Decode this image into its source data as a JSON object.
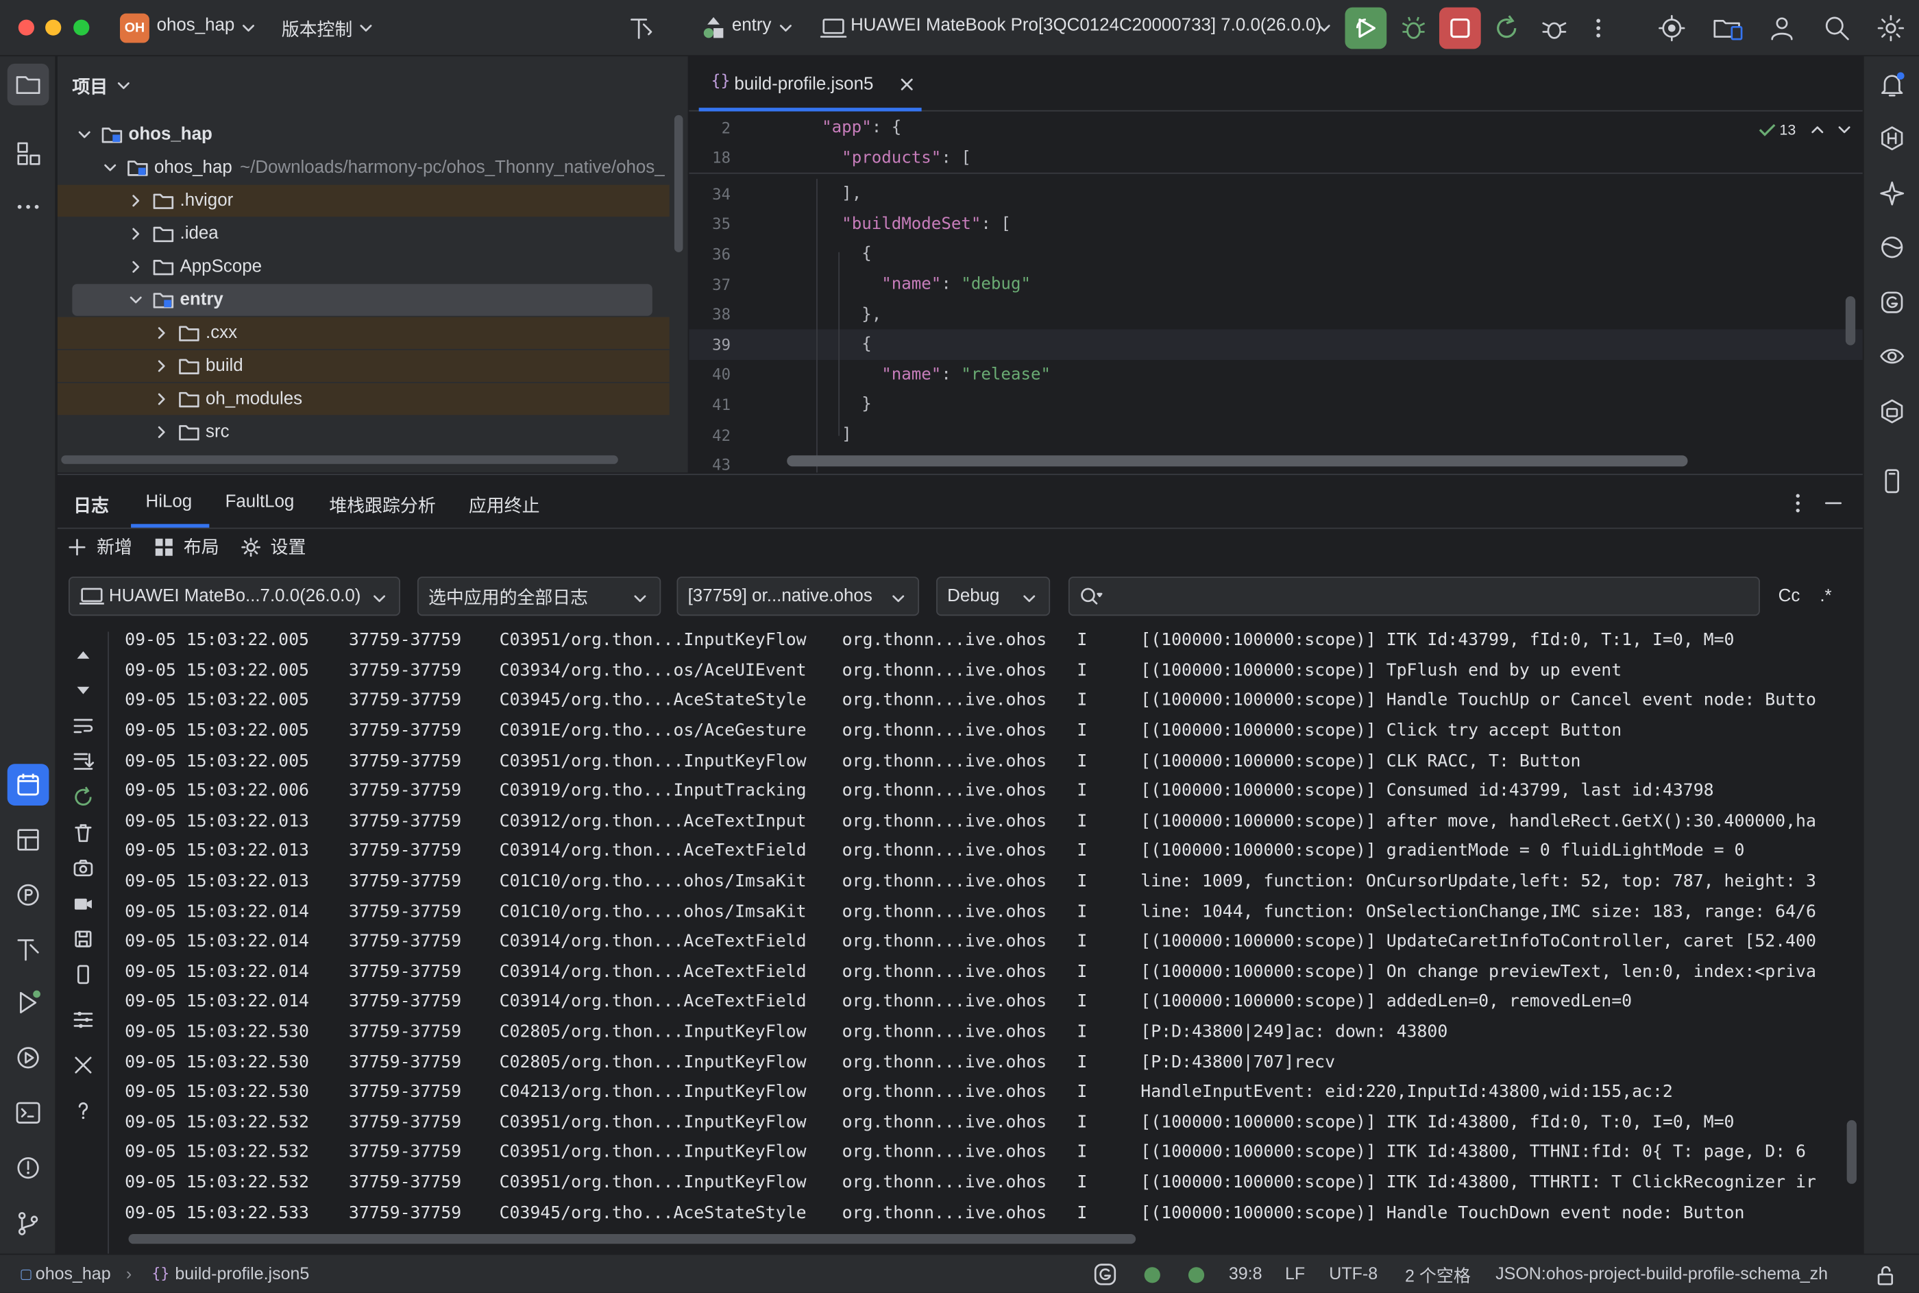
{
  "titlebar": {
    "project_badge": "OH",
    "project_name": "ohos_hap",
    "vcs_menu": "版本控制",
    "run_config": "entry",
    "device": "HUAWEI MateBook Pro[3QC0124C20000733] 7.0.0(26.0.0)",
    "colors": {
      "run_green": "#57965c",
      "stop_red": "#c94f4f",
      "badge": "#e0733e"
    }
  },
  "project_panel": {
    "title": "项目",
    "tree": [
      {
        "label": "ohos_hap",
        "bold": true,
        "expanded": true,
        "level": 0,
        "type": "module"
      },
      {
        "label": "ohos_hap",
        "path": "~/Downloads/harmony-pc/ohos_Thonny_native/ohos_",
        "expanded": true,
        "level": 1,
        "type": "module"
      },
      {
        "label": ".hvigor",
        "level": 2,
        "type": "folder",
        "excluded": true
      },
      {
        "label": ".idea",
        "level": 2,
        "type": "folder"
      },
      {
        "label": "AppScope",
        "level": 2,
        "type": "folder"
      },
      {
        "label": "entry",
        "bold": true,
        "expanded": true,
        "level": 2,
        "type": "module",
        "selected": true
      },
      {
        "label": ".cxx",
        "level": 3,
        "type": "folder",
        "excluded": true
      },
      {
        "label": "build",
        "level": 3,
        "type": "folder",
        "excluded": true
      },
      {
        "label": "oh_modules",
        "level": 3,
        "type": "folder",
        "excluded": true
      },
      {
        "label": "src",
        "level": 3,
        "type": "folder"
      }
    ]
  },
  "editor": {
    "tab": "build-profile.json5",
    "inspections": "13",
    "sticky": [
      {
        "n": "2",
        "indent": "    ",
        "parts": [
          [
            "k",
            "\"app\""
          ],
          [
            "p",
            ": {"
          ]
        ]
      },
      {
        "n": "18",
        "indent": "      ",
        "parts": [
          [
            "k",
            "\"products\""
          ],
          [
            "p",
            ": ["
          ]
        ]
      }
    ],
    "lines": [
      {
        "n": "34",
        "indent": "      ",
        "parts": [
          [
            "p",
            "],"
          ]
        ]
      },
      {
        "n": "35",
        "indent": "      ",
        "parts": [
          [
            "k",
            "\"buildModeSet\""
          ],
          [
            "p",
            ": ["
          ]
        ]
      },
      {
        "n": "36",
        "indent": "        ",
        "parts": [
          [
            "p",
            "{"
          ]
        ]
      },
      {
        "n": "37",
        "indent": "          ",
        "parts": [
          [
            "k",
            "\"name\""
          ],
          [
            "p",
            ": "
          ],
          [
            "s",
            "\"debug\""
          ]
        ]
      },
      {
        "n": "38",
        "indent": "        ",
        "parts": [
          [
            "p",
            "},"
          ]
        ]
      },
      {
        "n": "39",
        "indent": "        ",
        "parts": [
          [
            "p",
            "{"
          ]
        ],
        "current": true
      },
      {
        "n": "40",
        "indent": "          ",
        "parts": [
          [
            "k",
            "\"name\""
          ],
          [
            "p",
            ": "
          ],
          [
            "s",
            "\"release\""
          ]
        ]
      },
      {
        "n": "41",
        "indent": "        ",
        "parts": [
          [
            "p",
            "}"
          ]
        ]
      },
      {
        "n": "42",
        "indent": "      ",
        "parts": [
          [
            "p",
            "]"
          ]
        ]
      },
      {
        "n": "43",
        "indent": "",
        "parts": []
      }
    ]
  },
  "log_panel": {
    "tabs": [
      "日志",
      "HiLog",
      "FaultLog",
      "堆栈跟踪分析",
      "应用终止"
    ],
    "active_tab": "HiLog",
    "toolbar": {
      "add": "新增",
      "layout": "布局",
      "settings": "设置"
    },
    "filters": {
      "device": "HUAWEI MateBo...7.0.0(26.0.0)",
      "scope": "选中应用的全部日志",
      "process": "[37759] or...native.ohos",
      "level": "Debug",
      "search_placeholder": "",
      "case": "Cc",
      "regex": ".*"
    },
    "rows": [
      [
        "09-05 15:03:22.005",
        "37759-37759",
        "C03951/org.thon...InputKeyFlow",
        "org.thonn...ive.ohos",
        "I",
        "[(100000:100000:scope)] ITK Id:43799, fId:0, T:1, I=0, M=0"
      ],
      [
        "09-05 15:03:22.005",
        "37759-37759",
        "C03934/org.tho...os/AceUIEvent",
        "org.thonn...ive.ohos",
        "I",
        "[(100000:100000:scope)] TpFlush end by up event"
      ],
      [
        "09-05 15:03:22.005",
        "37759-37759",
        "C03945/org.tho...AceStateStyle",
        "org.thonn...ive.ohos",
        "I",
        "[(100000:100000:scope)] Handle TouchUp or Cancel event node: Butto"
      ],
      [
        "09-05 15:03:22.005",
        "37759-37759",
        "C0391E/org.tho...os/AceGesture",
        "org.thonn...ive.ohos",
        "I",
        "[(100000:100000:scope)] Click try accept Button"
      ],
      [
        "09-05 15:03:22.005",
        "37759-37759",
        "C03951/org.thon...InputKeyFlow",
        "org.thonn...ive.ohos",
        "I",
        "[(100000:100000:scope)] CLK RACC, T: Button"
      ],
      [
        "09-05 15:03:22.006",
        "37759-37759",
        "C03919/org.tho...InputTracking",
        "org.thonn...ive.ohos",
        "I",
        "[(100000:100000:scope)] Consumed id:43799, last id:43798"
      ],
      [
        "09-05 15:03:22.013",
        "37759-37759",
        "C03912/org.thon...AceTextInput",
        "org.thonn...ive.ohos",
        "I",
        "[(100000:100000:scope)] after move, handleRect.GetX():30.400000,ha"
      ],
      [
        "09-05 15:03:22.013",
        "37759-37759",
        "C03914/org.thon...AceTextField",
        "org.thonn...ive.ohos",
        "I",
        "[(100000:100000:scope)] gradientMode = 0 fluidLightMode = 0"
      ],
      [
        "09-05 15:03:22.013",
        "37759-37759",
        "C01C10/org.tho....ohos/ImsaKit",
        "org.thonn...ive.ohos",
        "I",
        "line: 1009, function: OnCursorUpdate,left: 52, top: 787, height: 3"
      ],
      [
        "09-05 15:03:22.014",
        "37759-37759",
        "C01C10/org.tho....ohos/ImsaKit",
        "org.thonn...ive.ohos",
        "I",
        "line: 1044, function: OnSelectionChange,IMC size: 183, range: 64/6"
      ],
      [
        "09-05 15:03:22.014",
        "37759-37759",
        "C03914/org.thon...AceTextField",
        "org.thonn...ive.ohos",
        "I",
        "[(100000:100000:scope)] UpdateCaretInfoToController, caret [52.400"
      ],
      [
        "09-05 15:03:22.014",
        "37759-37759",
        "C03914/org.thon...AceTextField",
        "org.thonn...ive.ohos",
        "I",
        "[(100000:100000:scope)] On change previewText, len:0, index:<priva"
      ],
      [
        "09-05 15:03:22.014",
        "37759-37759",
        "C03914/org.thon...AceTextField",
        "org.thonn...ive.ohos",
        "I",
        "[(100000:100000:scope)] addedLen=0, removedLen=0"
      ],
      [
        "09-05 15:03:22.530",
        "37759-37759",
        "C02805/org.thon...InputKeyFlow",
        "org.thonn...ive.ohos",
        "I",
        "[P:D:43800|249]ac: down: 43800"
      ],
      [
        "09-05 15:03:22.530",
        "37759-37759",
        "C02805/org.thon...InputKeyFlow",
        "org.thonn...ive.ohos",
        "I",
        "[P:D:43800|707]recv"
      ],
      [
        "09-05 15:03:22.530",
        "37759-37759",
        "C04213/org.thon...InputKeyFlow",
        "org.thonn...ive.ohos",
        "I",
        "HandleInputEvent: eid:220,InputId:43800,wid:155,ac:2"
      ],
      [
        "09-05 15:03:22.532",
        "37759-37759",
        "C03951/org.thon...InputKeyFlow",
        "org.thonn...ive.ohos",
        "I",
        "[(100000:100000:scope)] ITK Id:43800, fId:0, T:0, I=0, M=0"
      ],
      [
        "09-05 15:03:22.532",
        "37759-37759",
        "C03951/org.thon...InputKeyFlow",
        "org.thonn...ive.ohos",
        "I",
        "[(100000:100000:scope)] ITK Id:43800, TTHNI:fId: 0{ T: page, D: 6"
      ],
      [
        "09-05 15:03:22.532",
        "37759-37759",
        "C03951/org.thon...InputKeyFlow",
        "org.thonn...ive.ohos",
        "I",
        "[(100000:100000:scope)] ITK Id:43800, TTHRTI: T ClickRecognizer ir"
      ],
      [
        "09-05 15:03:22.533",
        "37759-37759",
        "C03945/org.tho...AceStateStyle",
        "org.thonn...ive.ohos",
        "I",
        "[(100000:100000:scope)] Handle TouchDown event node: Button"
      ]
    ]
  },
  "statusbar": {
    "project": "ohos_hap",
    "file": "build-profile.json5",
    "position": "39:8",
    "line_sep": "LF",
    "encoding": "UTF-8",
    "indent": "2 个空格",
    "schema": "JSON:ohos-project-build-profile-schema_zh"
  }
}
